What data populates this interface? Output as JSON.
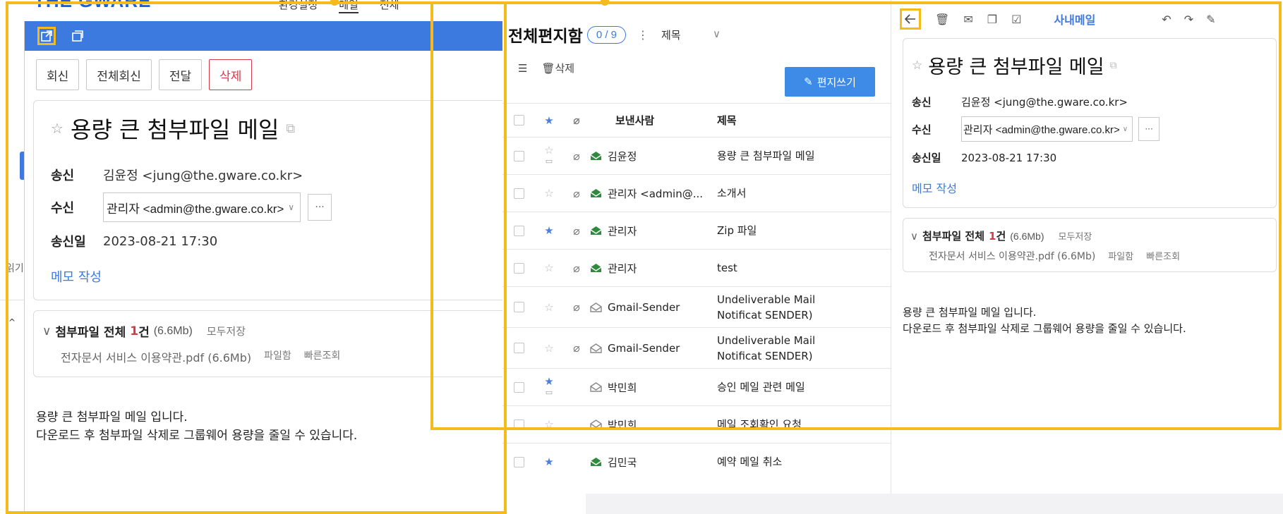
{
  "background": {
    "logo": "THE GWARE",
    "nav": [
      "환경설정",
      "메일",
      "전체"
    ],
    "left_label": "읽기"
  },
  "popup": {
    "buttons": {
      "reply": "회신",
      "reply_all": "전체회신",
      "forward": "전달",
      "delete": "삭제"
    },
    "subject": "용량 큰 첨부파일 메일",
    "from_label": "송신",
    "from_value": "김윤정 <jung@the.gware.co.kr>",
    "to_label": "수신",
    "to_value": "관리자 <admin@the.gware.co.kr>",
    "date_label": "송신일",
    "date_value": "2023-08-21 17:30",
    "memo": "메모 작성",
    "attach_title": "첨부파일 전체",
    "attach_count": "1",
    "attach_unit": "건",
    "attach_size": "(6.6Mb)",
    "attach_save_all": "모두저장",
    "file_name": "전자문서 서비스 이용약관.pdf (6.6Mb)",
    "file_open": "파일함",
    "file_quick": "빠른조회",
    "body_line1": "용량 큰 첨부파일 메일 입니다.",
    "body_line2": "다운로드 후 첨부파일 삭제로 그룹웨어 용량을 줄일 수 있습니다."
  },
  "list": {
    "title": "전체편지함",
    "counter": "0 / 9",
    "sort_label": "제목",
    "delete_label": "삭제",
    "compose_label": "편지쓰기",
    "col_from": "보낸사람",
    "col_subject": "제목",
    "rows": [
      {
        "from": "김윤정",
        "subject": "용량 큰 첨부파일 메일",
        "starred": false,
        "comment": true,
        "clip": true,
        "read": false
      },
      {
        "from": "관리자 <admin@...",
        "subject": "소개서",
        "starred": false,
        "comment": false,
        "clip": true,
        "read": false
      },
      {
        "from": "관리자",
        "subject": "Zip 파일",
        "starred": true,
        "comment": false,
        "clip": true,
        "read": false
      },
      {
        "from": "관리자",
        "subject": "test",
        "starred": false,
        "comment": false,
        "clip": true,
        "read": false
      },
      {
        "from": "Gmail-Sender",
        "subject": "Undeliverable Mail Notificat SENDER)",
        "starred": false,
        "comment": false,
        "clip": true,
        "read": true
      },
      {
        "from": "Gmail-Sender",
        "subject": "Undeliverable Mail Notificat SENDER)",
        "starred": false,
        "comment": false,
        "clip": true,
        "read": true
      },
      {
        "from": "박민희",
        "subject": "승인 메일 관련 메일",
        "starred": true,
        "comment": true,
        "clip": false,
        "read": true
      },
      {
        "from": "박민희",
        "subject": "메일 조회확인 요청",
        "starred": false,
        "comment": false,
        "clip": false,
        "read": true
      },
      {
        "from": "김민국",
        "subject": "예약 메일 취소",
        "starred": true,
        "comment": false,
        "clip": false,
        "read": false
      }
    ]
  },
  "reader": {
    "tab_label": "사내메일",
    "subject": "용량 큰 첨부파일 메일",
    "from_label": "송신",
    "from_value": "김윤정 <jung@the.gware.co.kr>",
    "to_label": "수신",
    "to_value": "관리자 <admin@the.gware.co.kr>",
    "date_label": "송신일",
    "date_value": "2023-08-21 17:30",
    "memo": "메모 작성",
    "attach_title": "첨부파일 전체",
    "attach_count": "1",
    "attach_unit": "건",
    "attach_size": "(6.6Mb)",
    "attach_save_all": "모두저장",
    "file_name": "전자문서 서비스 이용약관.pdf (6.6Mb)",
    "file_open": "파일함",
    "file_quick": "빠른조회",
    "body_line1": "용량 큰 첨부파일 메일 입니다.",
    "body_line2": "다운로드 후 첨부파일 삭제로 그룹웨어 용량을 줄일 수 있습니다."
  },
  "colors": {
    "accent": "#3d7ae0",
    "highlight": "#f5bb1c",
    "danger": "#d43a49",
    "unread_envelope": "#2e8b3e"
  }
}
